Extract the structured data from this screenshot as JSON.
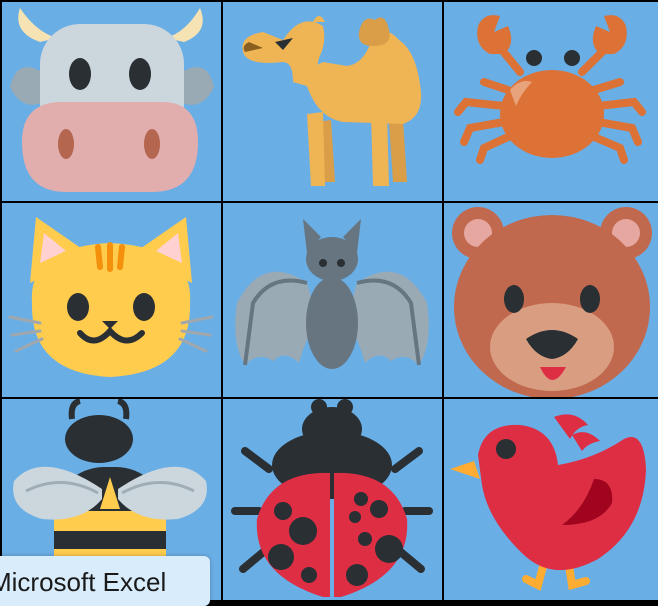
{
  "tiles": [
    {
      "animal": "cow-icon"
    },
    {
      "animal": "camel-icon"
    },
    {
      "animal": "crab-icon"
    },
    {
      "animal": "cat-icon"
    },
    {
      "animal": "bat-icon"
    },
    {
      "animal": "bear-icon"
    },
    {
      "animal": "bee-icon"
    },
    {
      "animal": "ladybug-icon"
    },
    {
      "animal": "bird-icon"
    }
  ],
  "colors": {
    "tile_bg": "#6aaee6",
    "grid_line": "#000000",
    "tooltip_bg": "#d9ecfb"
  },
  "tooltip": {
    "text": "Microsoft Excel"
  }
}
